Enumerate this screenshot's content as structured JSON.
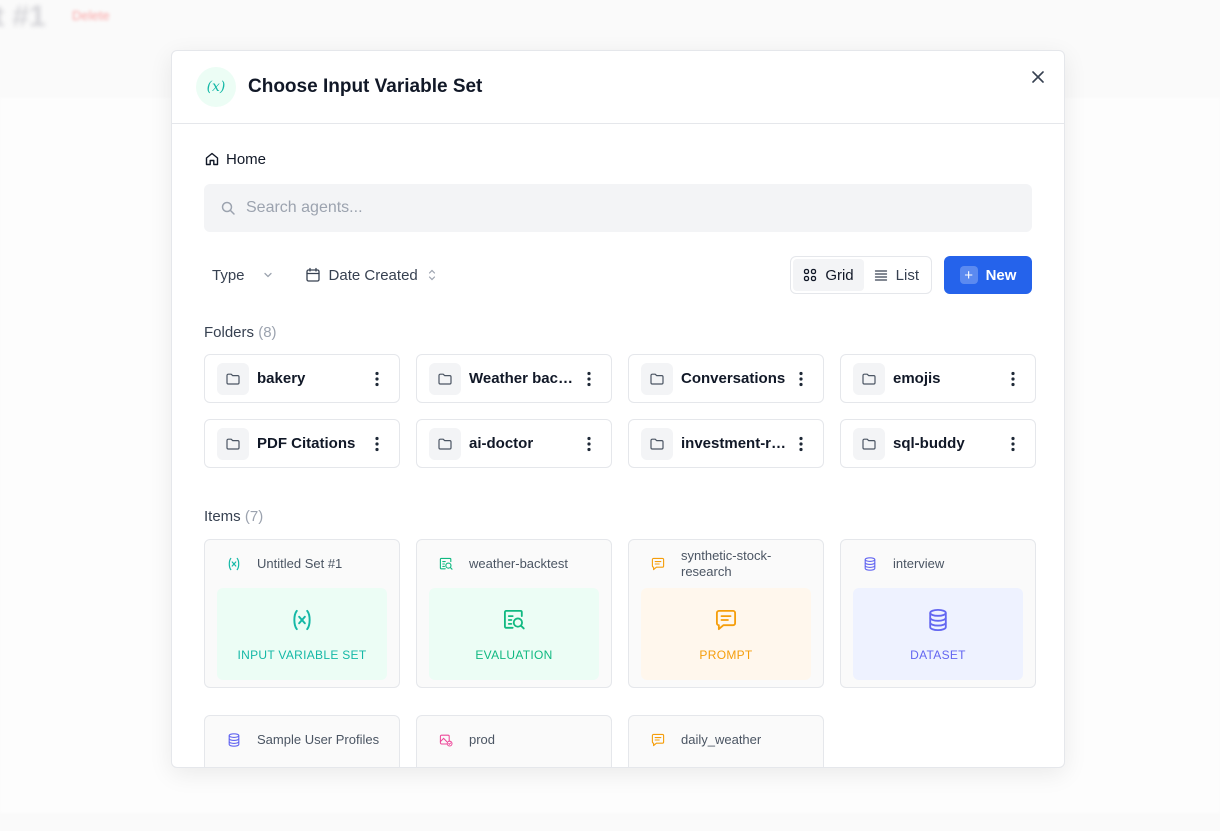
{
  "background": {
    "title_fragment": "t #1",
    "delete_label": "Delete"
  },
  "modal": {
    "title": "Choose Input Variable Set",
    "header_icon_glyph": "(x)"
  },
  "breadcrumb": {
    "home_label": "Home"
  },
  "search": {
    "placeholder": "Search agents...",
    "value": ""
  },
  "toolbar": {
    "type_filter": "Type",
    "date_filter": "Date Created",
    "grid_label": "Grid",
    "list_label": "List",
    "new_label": "New"
  },
  "folders": {
    "label": "Folders",
    "count": "(8)",
    "items": [
      {
        "name": "bakery"
      },
      {
        "name": "Weather backtest"
      },
      {
        "name": "Conversations"
      },
      {
        "name": "emojis"
      },
      {
        "name": "PDF Citations"
      },
      {
        "name": "ai-doctor"
      },
      {
        "name": "investment-research"
      },
      {
        "name": "sql-buddy"
      }
    ]
  },
  "items": {
    "label": "Items",
    "count": "(7)",
    "cards": [
      {
        "name": "Untitled Set #1",
        "type": "INPUT VARIABLE SET",
        "icon": "variable-icon",
        "color": "#14b8a6"
      },
      {
        "name": "weather-backtest",
        "type": "EVALUATION",
        "icon": "evaluation-icon",
        "color": "#10b981"
      },
      {
        "name": "synthetic-stock-research",
        "type": "PROMPT",
        "icon": "prompt-icon",
        "color": "#f59e0b"
      },
      {
        "name": "interview",
        "type": "DATASET",
        "icon": "dataset-icon",
        "color": "#6366f1"
      },
      {
        "name": "Sample User Profiles",
        "icon": "dataset-icon",
        "color": "#6366f1"
      },
      {
        "name": "prod",
        "icon": "deployment-icon",
        "color": "#ec4899"
      },
      {
        "name": "daily_weather",
        "icon": "prompt-icon",
        "color": "#f59e0b"
      }
    ]
  },
  "colors": {
    "accent": "#2563eb",
    "variable": "#14b8a6",
    "evaluation": "#10b981",
    "prompt": "#f59e0b",
    "dataset": "#6366f1",
    "deployment": "#ec4899"
  }
}
